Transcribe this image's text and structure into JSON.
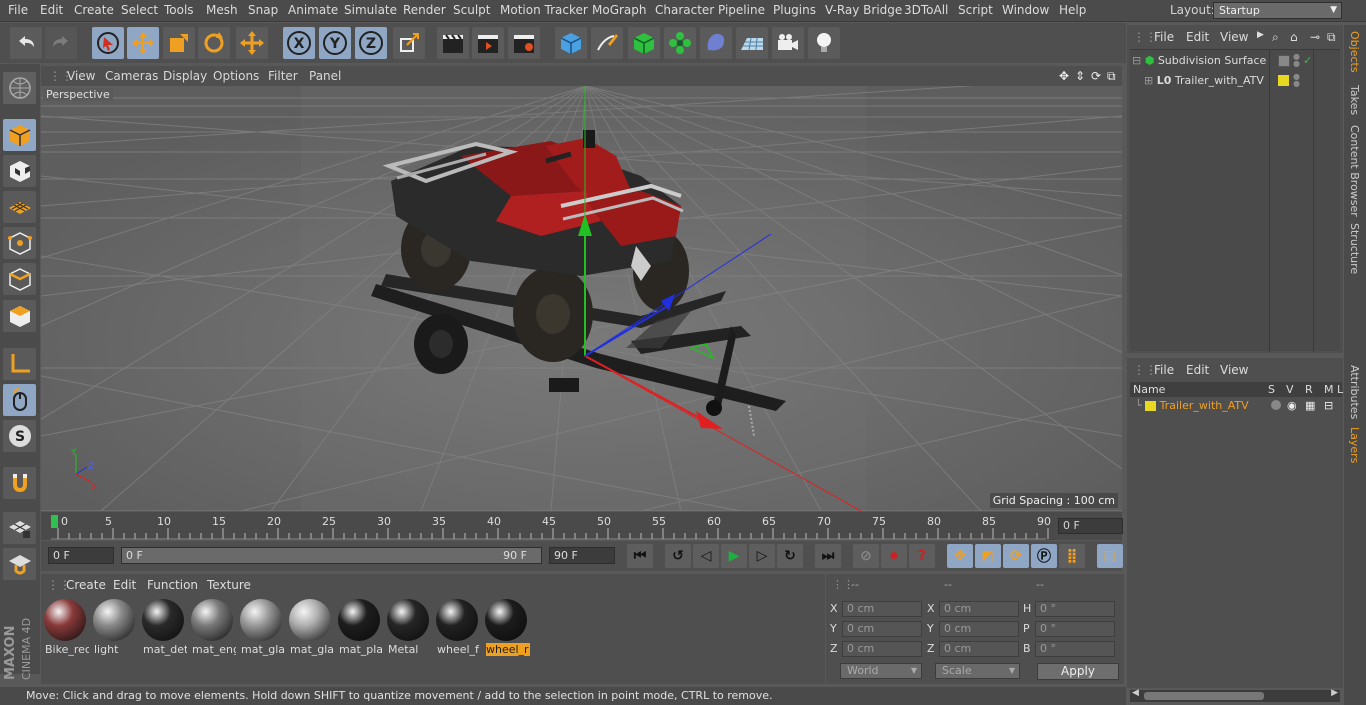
{
  "menu": {
    "items": [
      "File",
      "Edit",
      "Create",
      "Select",
      "Tools",
      "Mesh",
      "Snap",
      "Animate",
      "Simulate",
      "Render",
      "Sculpt",
      "Motion Tracker",
      "MoGraph",
      "Character",
      "Pipeline",
      "Plugins",
      "V-Ray Bridge",
      "3DToAll",
      "Script",
      "Window",
      "Help"
    ],
    "layout_label": "Layout:",
    "layout_value": "Startup"
  },
  "viewport": {
    "menu": [
      "View",
      "Cameras",
      "Display",
      "Options",
      "Filter",
      "Panel"
    ],
    "label": "Perspective",
    "grid_spacing": "Grid Spacing : 100 cm"
  },
  "timeline": {
    "ticks": [
      "0",
      "5",
      "10",
      "15",
      "20",
      "25",
      "30",
      "35",
      "40",
      "45",
      "50",
      "55",
      "60",
      "65",
      "70",
      "75",
      "80",
      "85",
      "90"
    ],
    "current_frame": "0 F"
  },
  "transport": {
    "start_field": "0 F",
    "range_start": "0 F",
    "range_end": "90 F",
    "end_field": "90 F"
  },
  "materials": {
    "menu": [
      "Create",
      "Edit",
      "Function",
      "Texture"
    ],
    "items": [
      {
        "name": "Bike_rec",
        "color": "#8a3a3a"
      },
      {
        "name": "light",
        "color": "#8a8a8a"
      },
      {
        "name": "mat_det",
        "color": "#2a2a2a"
      },
      {
        "name": "mat_eng",
        "color": "#7a7a7a"
      },
      {
        "name": "mat_gla",
        "color": "#9a9a9a"
      },
      {
        "name": "mat_gla",
        "color": "#b0b0b0"
      },
      {
        "name": "mat_pla",
        "color": "#1e1e1e"
      },
      {
        "name": "Metal",
        "color": "#262626"
      },
      {
        "name": "wheel_f",
        "color": "#222222"
      },
      {
        "name": "wheel_r",
        "color": "#1c1c1c"
      }
    ],
    "selected": "wheel_r"
  },
  "coords": {
    "headers": [
      "--",
      "--",
      "--"
    ],
    "rows": [
      {
        "a": "X",
        "av": "0 cm",
        "b": "X",
        "bv": "0 cm",
        "c": "H",
        "cv": "0 °"
      },
      {
        "a": "Y",
        "av": "0 cm",
        "b": "Y",
        "bv": "0 cm",
        "c": "P",
        "cv": "0 °"
      },
      {
        "a": "Z",
        "av": "0 cm",
        "b": "Z",
        "bv": "0 cm",
        "c": "B",
        "cv": "0 °"
      }
    ],
    "world": "World",
    "scale": "Scale",
    "apply": "Apply"
  },
  "status": "Move: Click and drag to move elements. Hold down SHIFT to quantize movement / add to the selection in point mode, CTRL to remove.",
  "objects": {
    "menu": [
      "File",
      "Edit",
      "View"
    ],
    "rows": [
      "Subdivision Surface",
      "Trailer_with_ATV"
    ]
  },
  "layers": {
    "menu": [
      "File",
      "Edit",
      "View"
    ],
    "columns": [
      "Name",
      "S",
      "V",
      "R",
      "M",
      "L"
    ],
    "rows": [
      "Trailer_with_ATV"
    ]
  },
  "side_tabs": {
    "top": [
      "Objects",
      "Takes",
      "Content Browser",
      "Structure"
    ],
    "bottom": [
      "Attributes",
      "Layers"
    ]
  },
  "colors": {
    "accent": "#f0a020",
    "layer_yellow": "#e8d820",
    "selected_blue": "#8fa7c4"
  },
  "logo_text": [
    "MAXON",
    "CINEMA 4D"
  ]
}
